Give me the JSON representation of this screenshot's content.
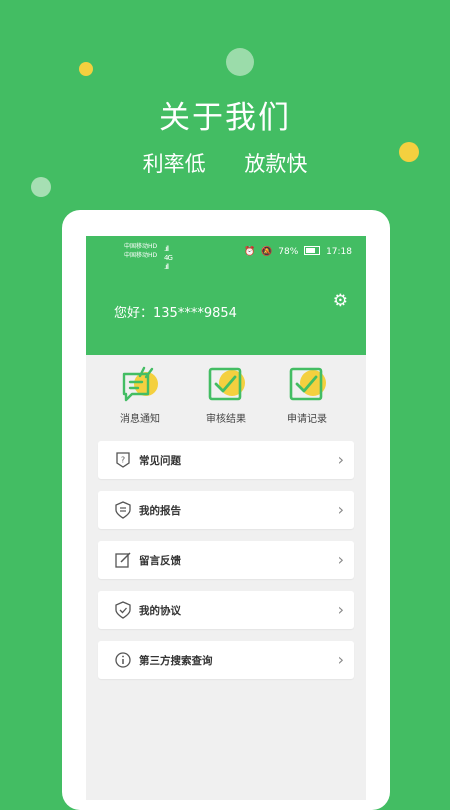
{
  "promo": {
    "headline": "关于我们",
    "tag1": "利率低",
    "tag2": "放款快"
  },
  "status_bar": {
    "carrier1": "中国移动",
    "carrier1_badge": "HD",
    "carrier2": "中国移动",
    "carrier2_badge": "HD",
    "network": "4G",
    "battery": "78%",
    "time": "17:18"
  },
  "header": {
    "greeting": "您好：135****9854"
  },
  "quick_actions": [
    {
      "label": "消息通知",
      "icon": "message-icon"
    },
    {
      "label": "审核结果",
      "icon": "review-check-icon"
    },
    {
      "label": "申请记录",
      "icon": "record-check-icon"
    }
  ],
  "menu": [
    {
      "label": "常见问题",
      "icon": "question-shield-icon"
    },
    {
      "label": "我的报告",
      "icon": "report-shield-icon"
    },
    {
      "label": "留言反馈",
      "icon": "edit-icon"
    },
    {
      "label": "我的协议",
      "icon": "check-shield-icon"
    },
    {
      "label": "第三方搜索查询",
      "icon": "info-icon"
    }
  ],
  "colors": {
    "brand_green": "#43bd63",
    "accent_yellow": "#f4d03f"
  }
}
